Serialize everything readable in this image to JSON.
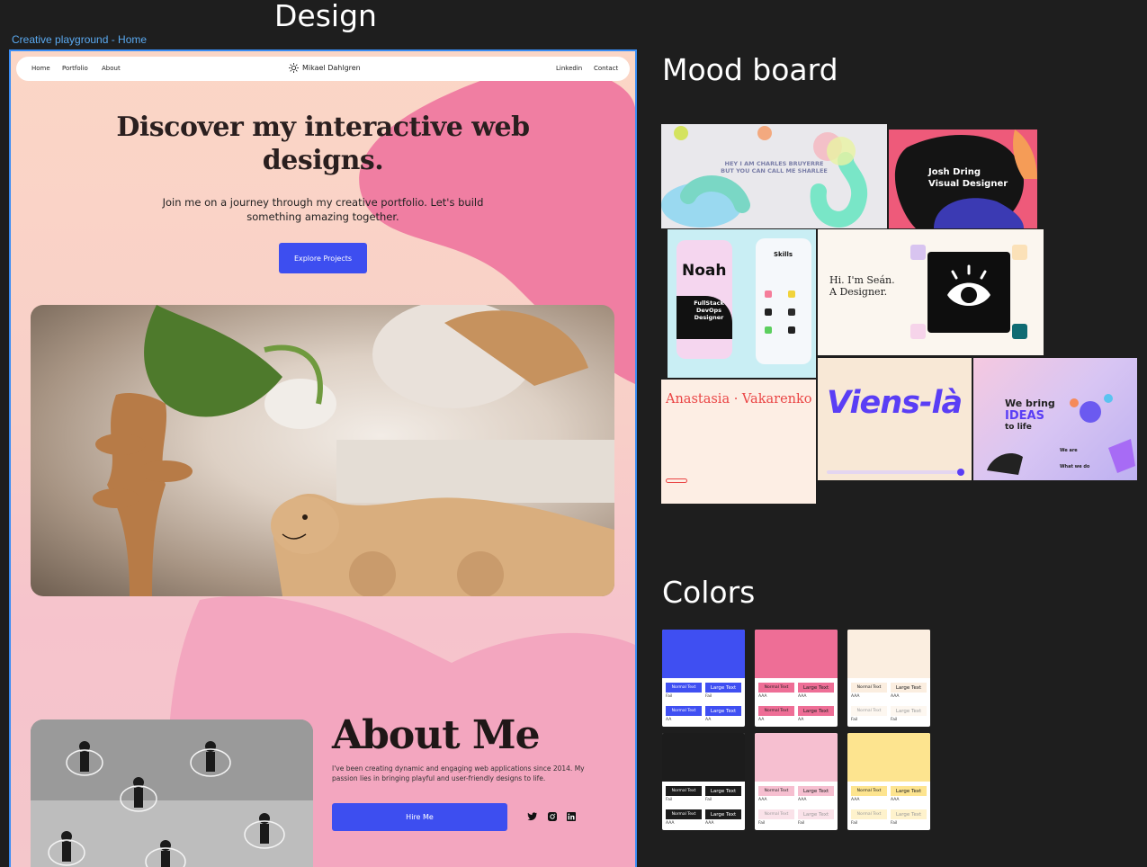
{
  "sections": {
    "design": "Design",
    "mood_board": "Mood board",
    "colors": "Colors"
  },
  "frame_label": "Creative playground - Home",
  "nav": {
    "links_left": [
      "Home",
      "Portfolio",
      "About"
    ],
    "brand": "Mikael Dahlgren",
    "links_right": [
      "Linkedin",
      "Contact"
    ],
    "brand_icon": "sun-icon"
  },
  "hero": {
    "heading": "Discover my interactive web designs.",
    "subtitle": "Join me on a journey through my creative portfolio. Let's build something amazing together.",
    "cta": "Explore Projects"
  },
  "about": {
    "heading": "About Me",
    "text": "I've been creating dynamic and engaging web applications since 2014. My passion lies in bringing playful and user-friendly designs to life.",
    "cta": "Hire Me",
    "socials": [
      "twitter-icon",
      "instagram-icon",
      "linkedin-icon"
    ]
  },
  "mood_board": {
    "charles": {
      "line1": "HEY I AM CHARLES BRUYERRE",
      "line2": "BUT YOU CAN CALL ME SHARLEE"
    },
    "josh": {
      "line1": "Josh Dring",
      "line2": "Visual Designer"
    },
    "noah": {
      "name": "Noah",
      "role": "FullStack DevOps Designer",
      "skills": "Skills"
    },
    "sean": {
      "line1": "Hi. I'm Seán.",
      "line2": "A Designer."
    },
    "anastasia": {
      "name": "Anastasia · Vakarenko"
    },
    "viens": {
      "name": "Viens-là"
    },
    "ideas": {
      "line1": "We bring",
      "line2": "IDEAS",
      "line3": "to life",
      "sub1": "We are",
      "sub2": "What we do"
    }
  },
  "colors": {
    "swatches": [
      {
        "color": "#3f4ff2",
        "normal": "Normal Text",
        "large": "Large Text",
        "r1": [
          "Fail",
          "Fail"
        ],
        "r2": [
          "AA",
          "AA"
        ],
        "chip_bg": "#3f4ff2",
        "chip_fg": "#ffffff"
      },
      {
        "color": "#ee6e96",
        "normal": "Normal Text",
        "large": "Large Text",
        "r1": [
          "AAA",
          "AAA"
        ],
        "r2": [
          "AA",
          "AA"
        ],
        "chip_bg": "#ee6e96",
        "chip_fg": "#222222"
      },
      {
        "color": "#fbeee0",
        "normal": "Normal Text",
        "large": "Large Text",
        "r1": [
          "AAA",
          "AAA"
        ],
        "r2": [
          "Fail",
          "Fail"
        ],
        "chip_bg": "#fbeee0",
        "chip_fg": "#222222"
      },
      {
        "color": "#1c1c1c",
        "normal": "Normal Text",
        "large": "Large Text",
        "r1": [
          "Fail",
          "Fail"
        ],
        "r2": [
          "AAA",
          "AAA"
        ],
        "chip_bg": "#1c1c1c",
        "chip_fg": "#ffffff"
      },
      {
        "color": "#f6bfd0",
        "normal": "Normal Text",
        "large": "Large Text",
        "r1": [
          "AAA",
          "AAA"
        ],
        "r2": [
          "Fail",
          "Fail"
        ],
        "chip_bg": "#f6bfd0",
        "chip_fg": "#222222"
      },
      {
        "color": "#fde48f",
        "normal": "Normal Text",
        "large": "Large Text",
        "r1": [
          "AAA",
          "AAA"
        ],
        "r2": [
          "Fail",
          "Fail"
        ],
        "chip_bg": "#fde48f",
        "chip_fg": "#222222"
      }
    ]
  }
}
